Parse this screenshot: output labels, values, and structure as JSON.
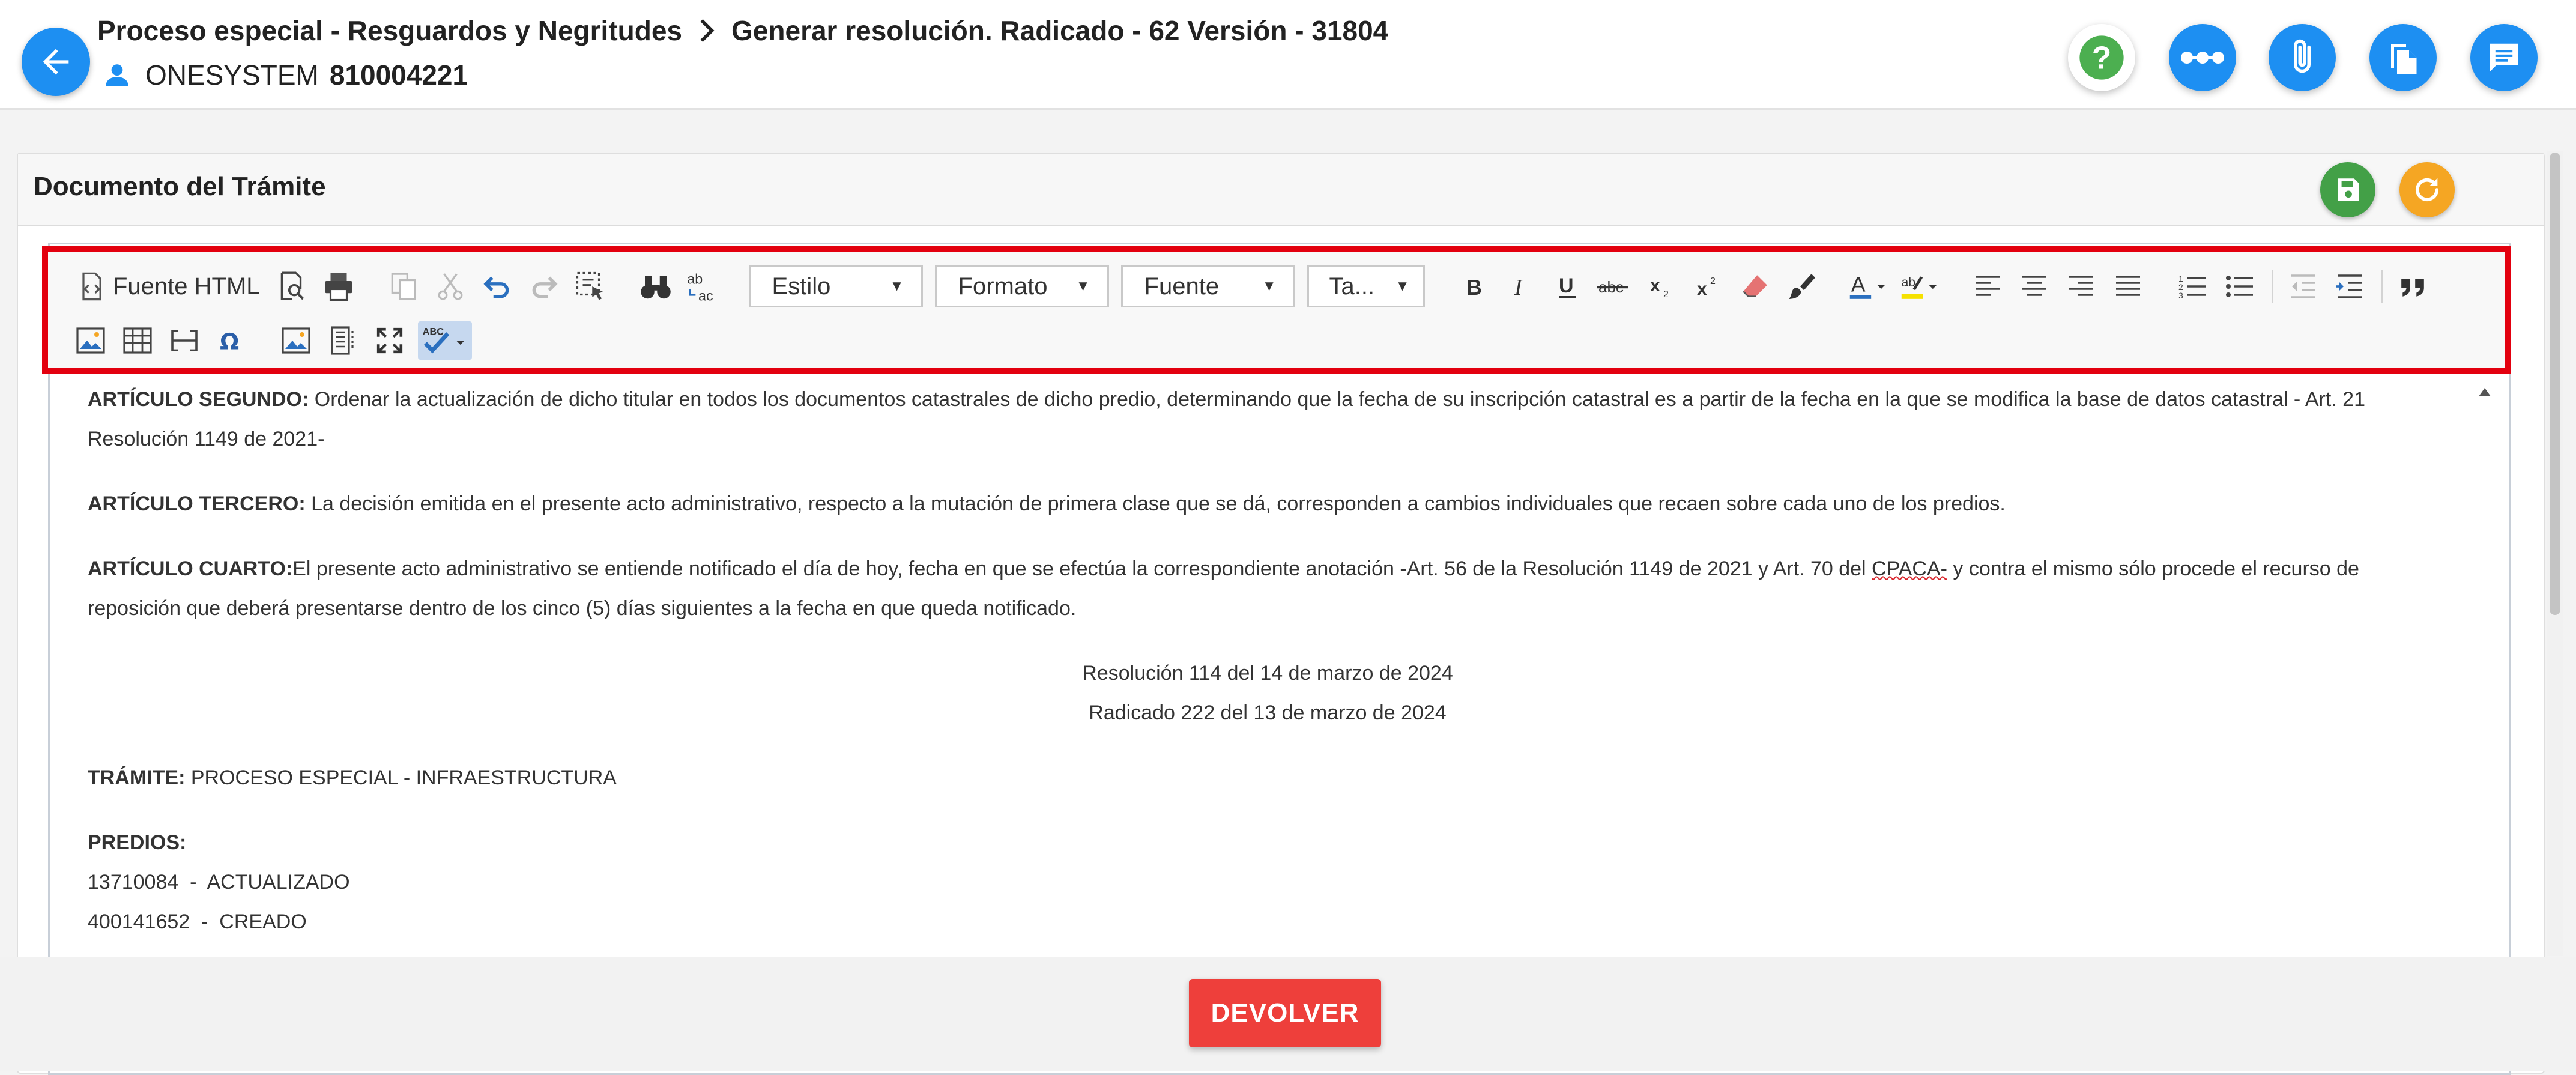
{
  "header": {
    "breadcrumb": [
      "Proceso especial - Resguardos y Negritudes",
      "Generar resolución. Radicado - 62 Versión - 31804"
    ],
    "user_name": "ONESYSTEM",
    "user_id": "810004221",
    "action_icons": [
      "help-icon",
      "more-icon",
      "attachment-icon",
      "documents-icon",
      "comments-icon"
    ]
  },
  "panel": {
    "title": "Documento del Trámite"
  },
  "toolbar": {
    "source_label": "Fuente HTML",
    "combos": {
      "style": "Estilo",
      "format": "Formato",
      "font": "Fuente",
      "size": "Ta..."
    },
    "spell_label": "ABC"
  },
  "document": {
    "art2_heading": "ARTÍCULO SEGUNDO:",
    "art2_text": " Ordenar la actualización de dicho titular en todos los documentos catastrales de dicho predio, determinando que la fecha de su inscripción catastral es a partir de la fecha en la que se modifica la base de datos catastral - Art. 21 Resolución 1149 de 2021-",
    "art3_heading": "ARTÍCULO TERCERO:",
    "art3_text": " La decisión emitida en el presente acto administrativo, respecto a la mutación de primera clase que se dá, corresponden a cambios individuales que recaen sobre cada uno de los predios.",
    "art4_heading": "ARTÍCULO CUARTO:",
    "art4_text_a": "El presente acto administrativo se entiende notificado el día de hoy, fecha en que se efectúa la correspondiente anotación -Art. 56 de la Resolución 1149 de 2021 y Art. 70 del ",
    "art4_flagged": "CPACA-",
    "art4_text_b": " y contra el mismo sólo procede el recurso de reposición que deberá presentarse dentro de los cinco (5) días siguientes a la fecha en que queda notificado.",
    "resolution_line": "Resolución 114 del 14 de marzo de 2024",
    "radicado_line": "Radicado 222 del 13 de marzo de 2024",
    "tramite_label": "TRÁMITE:",
    "tramite_value": " PROCESO ESPECIAL - INFRAESTRUCTURA",
    "predios_label": "PREDIOS:",
    "predios": [
      "13710084  -  ACTUALIZADO",
      "400141652  -  CREADO"
    ]
  },
  "footer": {
    "return_label": "DEVOLVER"
  },
  "colors": {
    "primary_blue": "#1d8ff2",
    "help_green": "#4caf50",
    "save_green": "#43a047",
    "refresh_orange": "#f5a623",
    "danger_red": "#ee3f3b",
    "highlight_red": "#e3000f"
  }
}
